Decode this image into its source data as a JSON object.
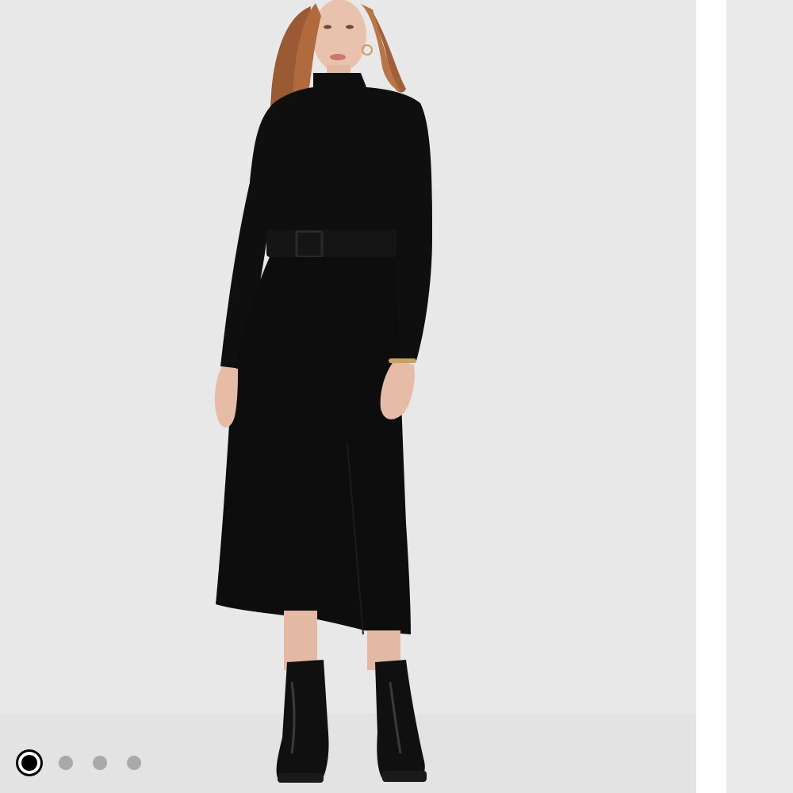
{
  "carousel": {
    "image_subject": "model-in-black-belted-turtleneck-midi-dress",
    "slide_count": 4,
    "active_index": 0,
    "colors": {
      "backdrop": "#e9e9e9",
      "dress": "#0d0d0d",
      "dot_active": "#000000",
      "dot_inactive": "#a9a9a9"
    }
  }
}
